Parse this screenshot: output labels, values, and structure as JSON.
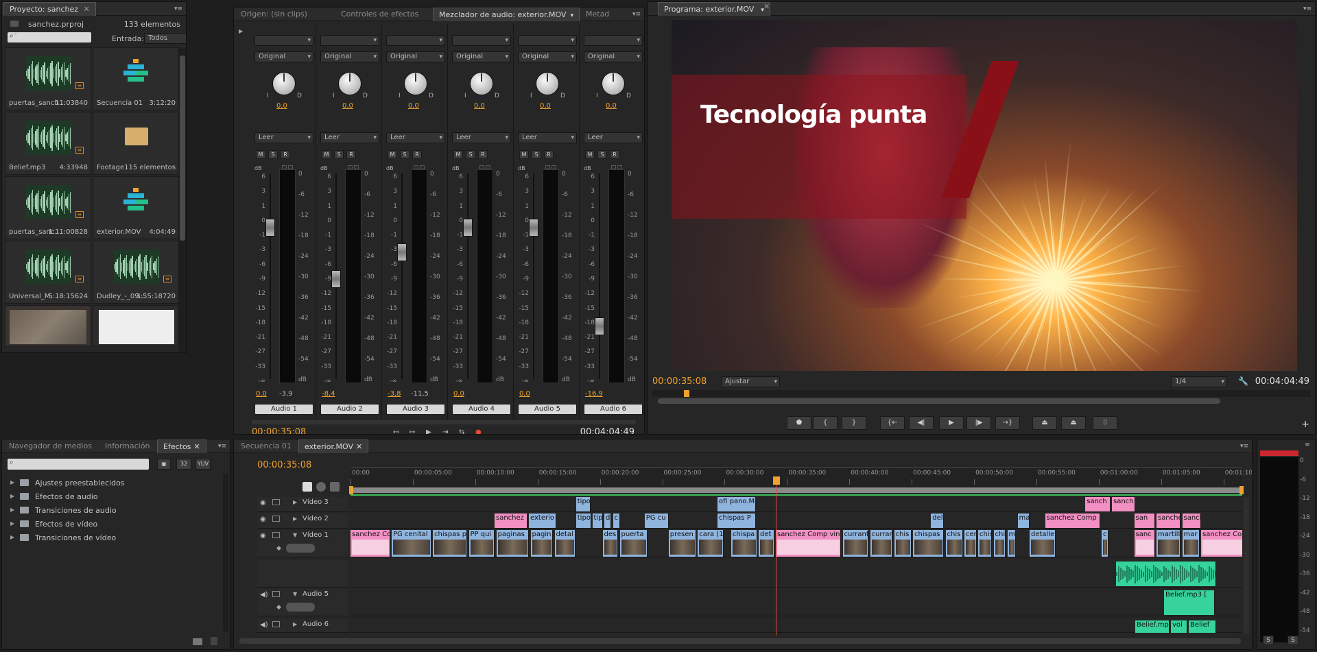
{
  "project": {
    "tab_label": "Proyecto: sanchez",
    "filename": "sanchez.prproj",
    "count": "133 elementos",
    "entrada_label": "Entrada:",
    "entrada_value": "Todos",
    "items": [
      {
        "name": "puertas_sanch…",
        "duration": "11:03840",
        "type": "audio"
      },
      {
        "name": "Secuencia 01",
        "duration": "3:12:20",
        "type": "sequence"
      },
      {
        "name": "Belief.mp3",
        "duration": "4:33948",
        "type": "audio"
      },
      {
        "name": "Footage",
        "duration": "115 elementos",
        "type": "folder"
      },
      {
        "name": "puertas_sanc…",
        "duration": "1:11:00828",
        "type": "audio"
      },
      {
        "name": "exterior.MOV",
        "duration": "4:04:49",
        "type": "sequence"
      },
      {
        "name": "Universal_M…",
        "duration": "5:18:15624",
        "type": "audio"
      },
      {
        "name": "Dudley_-_09…",
        "duration": "3:55:18720",
        "type": "audio"
      }
    ]
  },
  "mixer": {
    "tabs": [
      "Origen: (sin clips)",
      "Controles de efectos",
      "Mezclador de audio: exterior.MOV",
      "Metad"
    ],
    "timecode_left": "00:00:35:08",
    "timecode_right": "00:04:04:49",
    "channels": [
      {
        "name": "Audio 1",
        "preset": "Original",
        "mode": "Leer",
        "pan": "0,0",
        "vol": "0,0",
        "peak": "-3,9",
        "fader": 0.78
      },
      {
        "name": "Audio 2",
        "preset": "Original",
        "mode": "Leer",
        "pan": "0,0",
        "vol": "-8,4",
        "peak": "",
        "fader": 0.53
      },
      {
        "name": "Audio 3",
        "preset": "Original",
        "mode": "Leer",
        "pan": "0,0",
        "vol": "-3,8",
        "peak": "-11,5",
        "fader": 0.66
      },
      {
        "name": "Audio 4",
        "preset": "Original",
        "mode": "Leer",
        "pan": "0,0",
        "vol": "0,0",
        "peak": "",
        "fader": 0.78
      },
      {
        "name": "Audio 5",
        "preset": "Original",
        "mode": "Leer",
        "pan": "0,0",
        "vol": "0,0",
        "peak": "",
        "fader": 0.78
      },
      {
        "name": "Audio 6",
        "preset": "Original",
        "mode": "Leer",
        "pan": "0,0",
        "vol": "-16,9",
        "peak": "",
        "fader": 0.3
      }
    ],
    "db_scale_left": [
      "6",
      "3",
      "1",
      "0",
      "-1",
      "-3",
      "-6",
      "-9",
      "-12",
      "-15",
      "-18",
      "-21",
      "-27",
      "-33",
      "-∞"
    ],
    "db_scale_right": [
      "0",
      "-6",
      "-12",
      "-18",
      "-24",
      "-30",
      "-36",
      "-42",
      "-48",
      "-54",
      "dB"
    ],
    "db_label": "dB",
    "pan_l": "I",
    "pan_r": "D",
    "msr": [
      "M",
      "S",
      "R"
    ]
  },
  "program": {
    "tab_label": "Programa: exterior.MOV",
    "title_text": "Tecnología punta",
    "timecode_left": "00:00:35:08",
    "fit": "Ajustar",
    "resolution": "1/4",
    "timecode_right": "00:04:04:49"
  },
  "effects": {
    "tabs": [
      "Navegador de medios",
      "Información",
      "Efectos"
    ],
    "buttons": [
      "32",
      "YUV"
    ],
    "folders": [
      "Ajustes preestablecidos",
      "Efectos de audio",
      "Transiciones de audio",
      "Efectos de vídeo",
      "Transiciones de vídeo"
    ]
  },
  "timeline": {
    "tabs": [
      "Secuencia 01",
      "exterior.MOV"
    ],
    "timecode": "00:00:35:08",
    "ruler": [
      "00:00",
      "00:00:05:00",
      "00:00:10:00",
      "00:00:15:00",
      "00:00:20:00",
      "00:00:25:00",
      "00:00:30:00",
      "00:00:35:00",
      "00:00:40:00",
      "00:00:45:00",
      "00:00:50:00",
      "00:00:55:00",
      "00:01:00:00",
      "00:01:05:00",
      "00:01:10:00"
    ],
    "tracks": [
      "Vídeo 3",
      "Vídeo 2",
      "Vídeo 1",
      "Audio 5",
      "Audio 6"
    ],
    "v3_clips": [
      [
        "tipo",
        263,
        17,
        "blue"
      ],
      [
        "ofi pano.M",
        428,
        45,
        "blue"
      ],
      [
        "sanch",
        857,
        29,
        "pink"
      ],
      [
        "sanch",
        888,
        27,
        "pink"
      ]
    ],
    "v2_clips": [
      [
        "sanchez",
        168,
        38,
        "pink"
      ],
      [
        "exterio",
        208,
        32,
        "blue"
      ],
      [
        "tipo",
        263,
        18,
        "blue"
      ],
      [
        "tip",
        282,
        12,
        "blue"
      ],
      [
        "d",
        296,
        8,
        "blue"
      ],
      [
        "c",
        306,
        8,
        "blue"
      ],
      [
        "PG cu",
        343,
        28,
        "blue"
      ],
      [
        "chispas P",
        428,
        45,
        "blue"
      ],
      [
        "del",
        677,
        15,
        "blue"
      ],
      [
        "ma",
        778,
        14,
        "blue"
      ],
      [
        "sanchez Comp",
        810,
        64,
        "pink"
      ],
      [
        "san",
        914,
        24,
        "pink"
      ],
      [
        "sanche",
        940,
        28,
        "pink"
      ],
      [
        "sancl",
        970,
        22,
        "pink"
      ]
    ],
    "v1_clips": [
      [
        "sanchez Co",
        0,
        46,
        "pink"
      ],
      [
        "PG cenital",
        48,
        46,
        "blue"
      ],
      [
        "chispas p",
        96,
        40,
        "blue"
      ],
      [
        "PP qui",
        138,
        30,
        "blue"
      ],
      [
        "paginas",
        170,
        38,
        "blue"
      ],
      [
        "pagin",
        210,
        26,
        "blue"
      ],
      [
        "detal",
        238,
        24,
        "blue"
      ],
      [
        "des",
        294,
        18,
        "blue"
      ],
      [
        "puerta",
        314,
        32,
        "blue"
      ],
      [
        "presen",
        371,
        32,
        "blue"
      ],
      [
        "cara (1",
        405,
        30,
        "blue"
      ],
      [
        "chispa",
        444,
        30,
        "blue"
      ],
      [
        "det",
        476,
        18,
        "blue"
      ],
      [
        "sanchez Comp vin",
        496,
        76,
        "pink"
      ],
      [
        "currant",
        574,
        30,
        "blue"
      ],
      [
        "currar",
        606,
        26,
        "blue"
      ],
      [
        "chis",
        634,
        20,
        "blue"
      ],
      [
        "chispas",
        656,
        36,
        "blue"
      ],
      [
        "chis",
        694,
        20,
        "blue"
      ],
      [
        "cer",
        716,
        14,
        "blue"
      ],
      [
        "chis",
        732,
        16,
        "blue"
      ],
      [
        "chi",
        750,
        14,
        "blue"
      ],
      [
        "m",
        766,
        10,
        "blue"
      ],
      [
        "detalle",
        792,
        30,
        "blue"
      ],
      [
        "c",
        876,
        8,
        "blue"
      ],
      [
        "sanc",
        914,
        24,
        "pink"
      ],
      [
        "martill",
        940,
        28,
        "blue"
      ],
      [
        "mar",
        970,
        20,
        "blue"
      ],
      [
        "sanchez Comp",
        992,
        62,
        "pink"
      ]
    ],
    "a_clips": [
      [
        "Belief.mp3 [",
        1000,
        56,
        "green"
      ],
      [
        "Belief.mp3",
        960,
        48,
        "green"
      ],
      [
        "vol",
        1010,
        22,
        "green"
      ],
      [
        "Belief",
        1036,
        22,
        "green"
      ]
    ]
  },
  "meter": {
    "scale": [
      "0",
      "-6",
      "-12",
      "-18",
      "-24",
      "-30",
      "-36",
      "-42",
      "-48",
      "-54"
    ],
    "buttons": [
      "S",
      "S"
    ]
  }
}
